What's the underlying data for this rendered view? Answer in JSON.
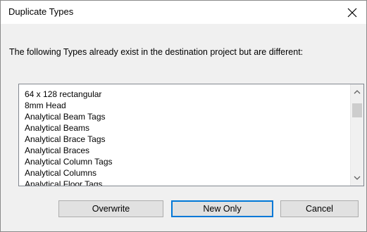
{
  "dialog": {
    "title": "Duplicate Types",
    "close_glyph": "✕",
    "message": "The following Types already exist in the destination project but are different:"
  },
  "list": {
    "items": [
      "64 x 128 rectangular",
      "8mm Head",
      "Analytical Beam Tags",
      "Analytical Beams",
      "Analytical Brace Tags",
      "Analytical Braces",
      "Analytical Column Tags",
      "Analytical Columns",
      "Analytical Floor Tags"
    ],
    "scroll_up_glyph": "∧",
    "scroll_down_glyph": "∨"
  },
  "buttons": {
    "overwrite": "Overwrite",
    "new_only": "New Only",
    "cancel": "Cancel"
  },
  "colors": {
    "default_button_border": "#0078d7",
    "button_background": "#e1e1e1"
  }
}
